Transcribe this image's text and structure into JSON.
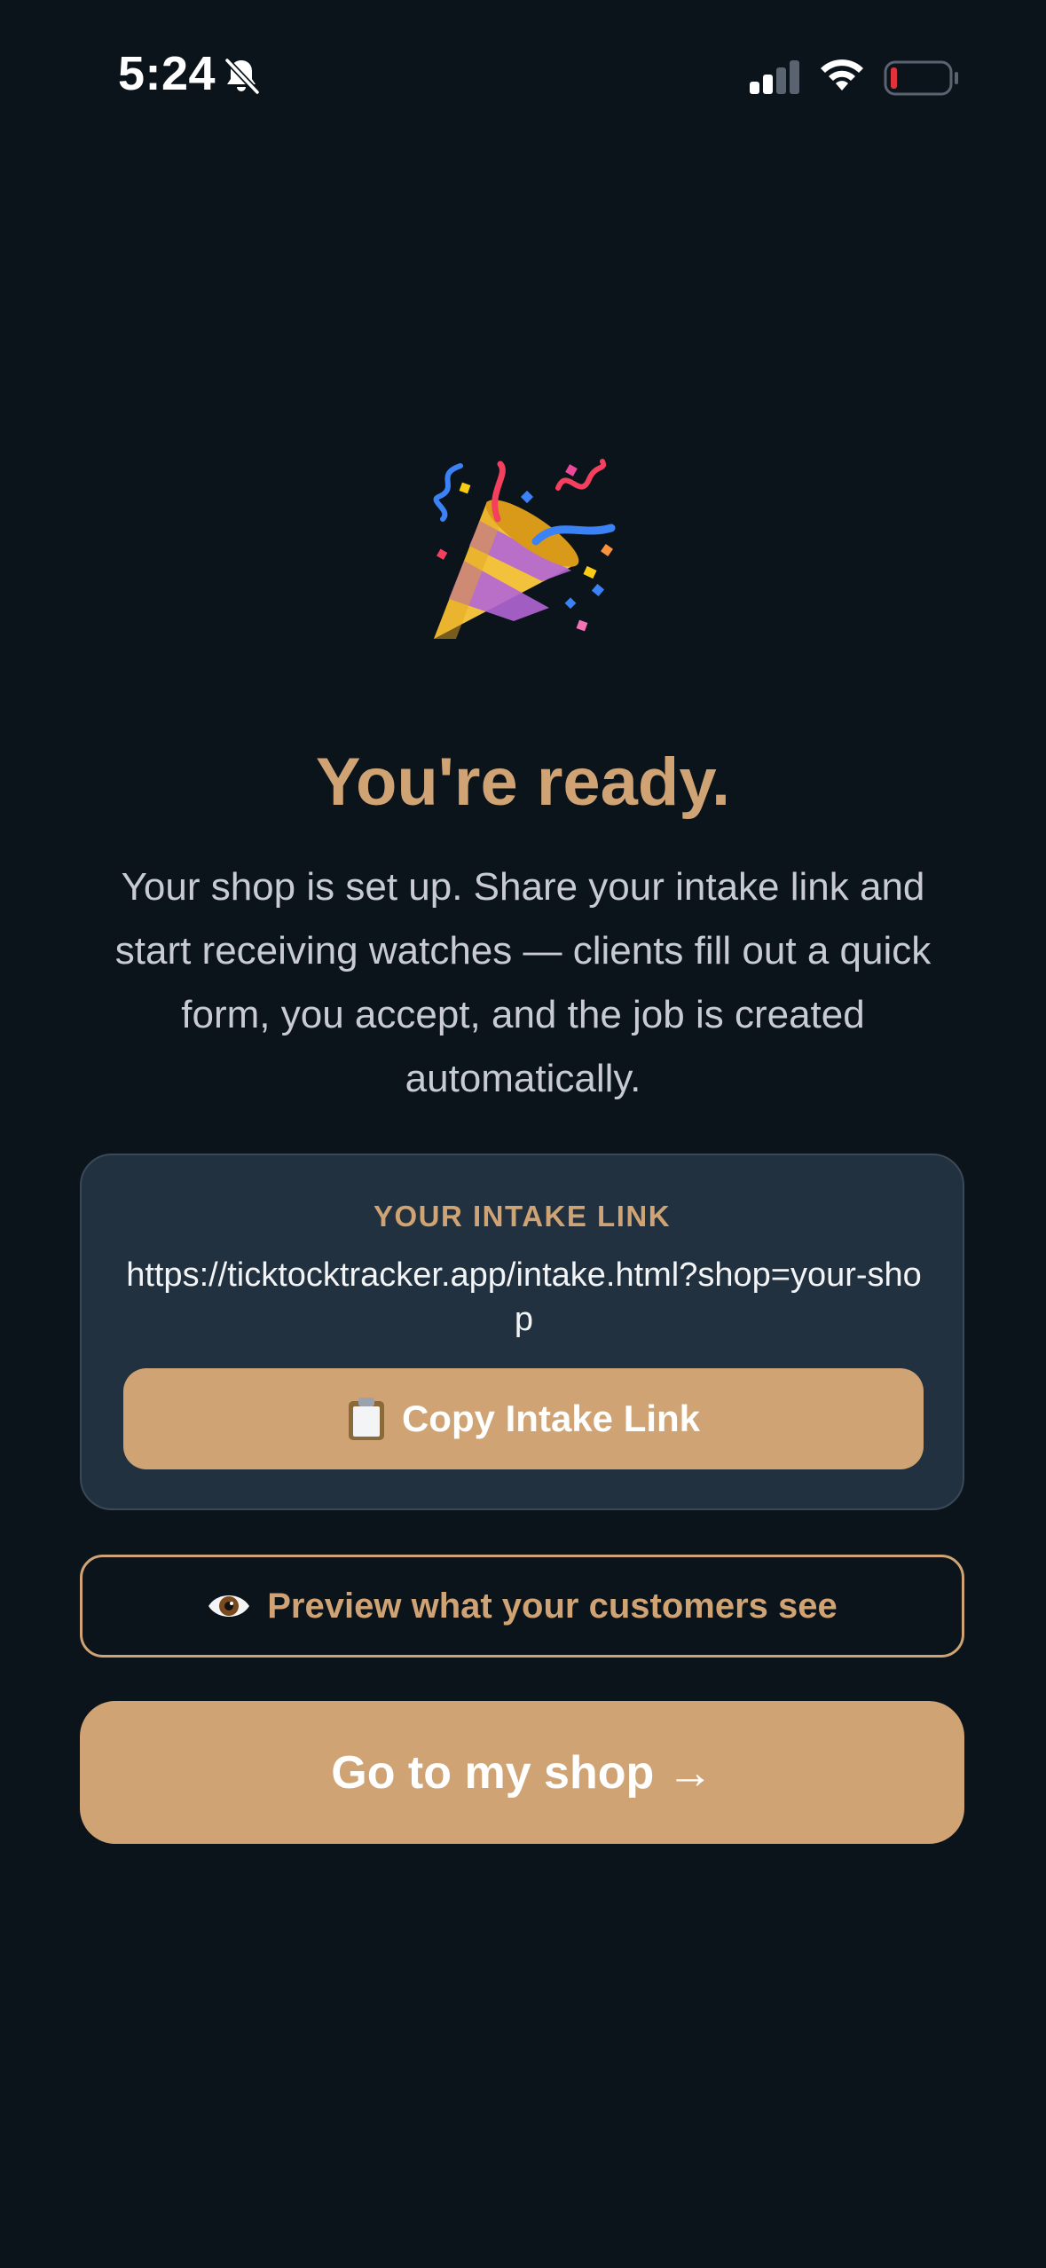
{
  "status_bar": {
    "time": "5:24",
    "icons": [
      "bell-slash-icon",
      "cellular-signal-icon",
      "wifi-icon",
      "battery-low-icon"
    ],
    "battery_color": "#e0323a"
  },
  "hero": {
    "icon": "party-popper-icon",
    "title": "You're ready.",
    "description": "Your shop is set up. Share your intake link and start receiving watches — clients fill out a quick form, you accept, and the job is created automatically."
  },
  "intake_card": {
    "label": "YOUR INTAKE LINK",
    "url": "https://ticktocktracker.app/intake.html?shop=your-shop",
    "copy_icon": "clipboard-icon",
    "copy_label": "Copy Intake Link"
  },
  "preview": {
    "icon": "eye-icon",
    "label": "Preview what your customers see"
  },
  "go_button": {
    "label": "Go to my shop →"
  },
  "colors": {
    "background": "#0b131b",
    "accent": "#cfa373",
    "card": "#22313f",
    "text_muted": "#c8ccd2"
  }
}
